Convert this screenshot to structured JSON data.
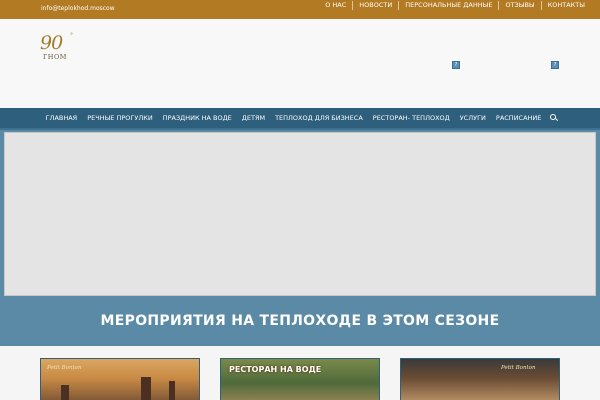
{
  "topbar": {
    "email": "info@teplokhod.moscow",
    "links": [
      "О НАС",
      "НОВОСТИ",
      "ПЕРСОНАЛЬНЫЕ ДАННЫЕ",
      "ОТЗЫВЫ",
      "КОНТАКТЫ"
    ]
  },
  "header": {
    "logo_number": "90",
    "logo_sup": "°",
    "logo_word": "ГНОМ"
  },
  "mainnav": {
    "items": [
      "ГЛАВНАЯ",
      "РЕЧНЫЕ ПРОГУЛКИ",
      "ПРАЗДНИК НА ВОДЕ",
      "ДЕТЯМ",
      "ТЕПЛОХОД ДЛЯ БИЗНЕСА",
      "РЕСТОРАН- ТЕПЛОХОД",
      "УСЛУГИ",
      "РАСПИСАНИЕ"
    ],
    "search_icon": "search-icon"
  },
  "banner": {
    "title": "МЕРОПРИЯТИЯ НА ТЕПЛОХОДЕ В ЭТОМ СЕЗОНЕ"
  },
  "cards": [
    {
      "brand": "Petit Bonton"
    },
    {
      "caption": "РЕСТОРАН НА ВОДЕ"
    },
    {
      "brand": "Petit Bonton"
    }
  ],
  "colors": {
    "topbar": "#b27a23",
    "nav": "#2e5f7c",
    "banner": "#5a8aa6"
  }
}
